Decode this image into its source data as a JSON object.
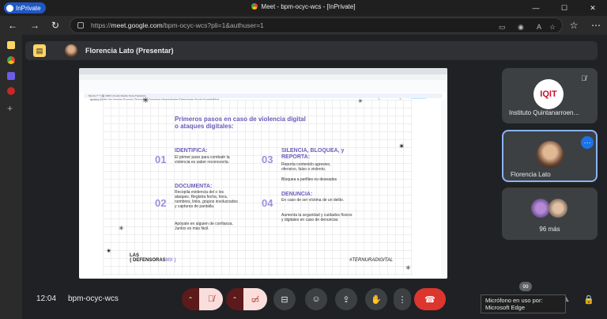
{
  "browser": {
    "inprivate_label": "InPrivate",
    "window_title": "Meet - bpm-ocyc-wcs - [InPrivate]",
    "url_prefix": "https://",
    "url_host": "meet.google.com",
    "url_path": "/bpm-ocyc-wcs?pli=1&authuser=1",
    "controls": {
      "minimize": "—",
      "maximize": "☐",
      "close": "✕"
    }
  },
  "meet": {
    "presenter_label": "Florencia Lato (Presentar)",
    "meeting_code": "bpm-ocyc-wcs",
    "time": "12:04",
    "tooltip_line1": "Micrófono en uso por:",
    "tooltip_line2": "Microsoft Edge",
    "badge_count": "99",
    "tiles": [
      {
        "name": "Instituto Quintanarroen…",
        "logo": "IQIT"
      },
      {
        "name": "Florencia Lato"
      },
      {
        "name": "96 más"
      }
    ]
  },
  "shared_doc": {
    "doc_title": "PREVENCIÓN Violencia Digital y seguridad en Internet",
    "doc_menu": "Archivo   Editar   Ver   Insertar   Formato   Diapositiva   Organizar   Herramientas   Extensiones   Ayuda   Accesibilidad",
    "toolbar": "Menús   ↶  ↷  🖨  100%   |   Fondo   Diseño   Tema   Transición",
    "present_button": "Presentación",
    "share_button": "Compartir",
    "slide": {
      "title": "Primeros pasos en caso de violencia digital o ataques digitales:",
      "items": [
        {
          "num": "01",
          "heading": "IDENTIFICA:",
          "text": "El primer paso para combatir la violencia es saber reconocerla."
        },
        {
          "num": "02",
          "heading": "DOCUMENTA:",
          "text": "Recopila evidencia del o los ataques. Registra fecha, hora, nombres, links, grupos involucrados y capturas de pantalla.",
          "text2": "Apóyate en alguien de confianza. Juntxs es más fácil."
        },
        {
          "num": "03",
          "heading": "SILENCIA, BLOQUEA, y REPORTA:",
          "text": "Reporta contenido agresivo, ofensivo, falso o violento.",
          "text2": "Bloquea a perfiles no deseados"
        },
        {
          "num": "04",
          "heading": "DENUNCIA:",
          "text": "En caso de ser víctima de un delito.",
          "text2": "Aumenta la seguridad y cuidados físicos y digitales en caso de denunciar."
        }
      ],
      "brand_left": "LAS",
      "brand_left2": "{ DEFENSORAS",
      "brand_left_mx": "MX }",
      "brand_right": "#TERNURADIGITAL"
    }
  },
  "colors": {
    "slide_purple": "#6c5bb9",
    "slide_light_purple": "#9b8fe0",
    "end_call_red": "#dc362e",
    "inprivate_blue": "#1f58c4"
  }
}
